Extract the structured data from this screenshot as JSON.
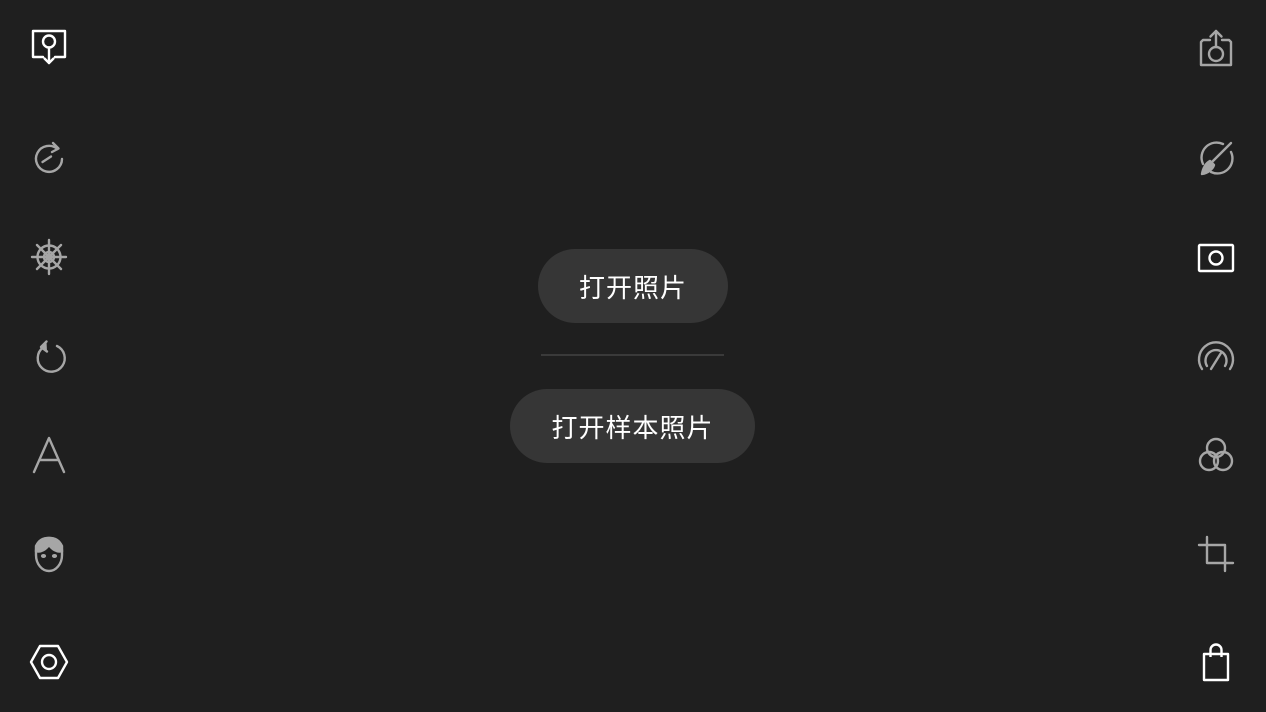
{
  "colors": {
    "background": "#1f1f1f",
    "pill": "#363636",
    "icon_active": "#ffffff",
    "icon_inactive": "#a6a6a6",
    "divider": "#3a3a3a"
  },
  "center": {
    "open_photo_label": "打开照片",
    "open_sample_label": "打开样本照片"
  },
  "left_toolbar": [
    "open-image-icon",
    "redo-icon",
    "ship-wheel-icon",
    "undo-icon",
    "text-icon",
    "face-icon",
    "settings-hex-icon"
  ],
  "right_toolbar": [
    "share-icon",
    "brush-icon",
    "photo-frame-icon",
    "gauge-icon",
    "color-mix-icon",
    "crop-icon",
    "shopping-bag-icon"
  ]
}
